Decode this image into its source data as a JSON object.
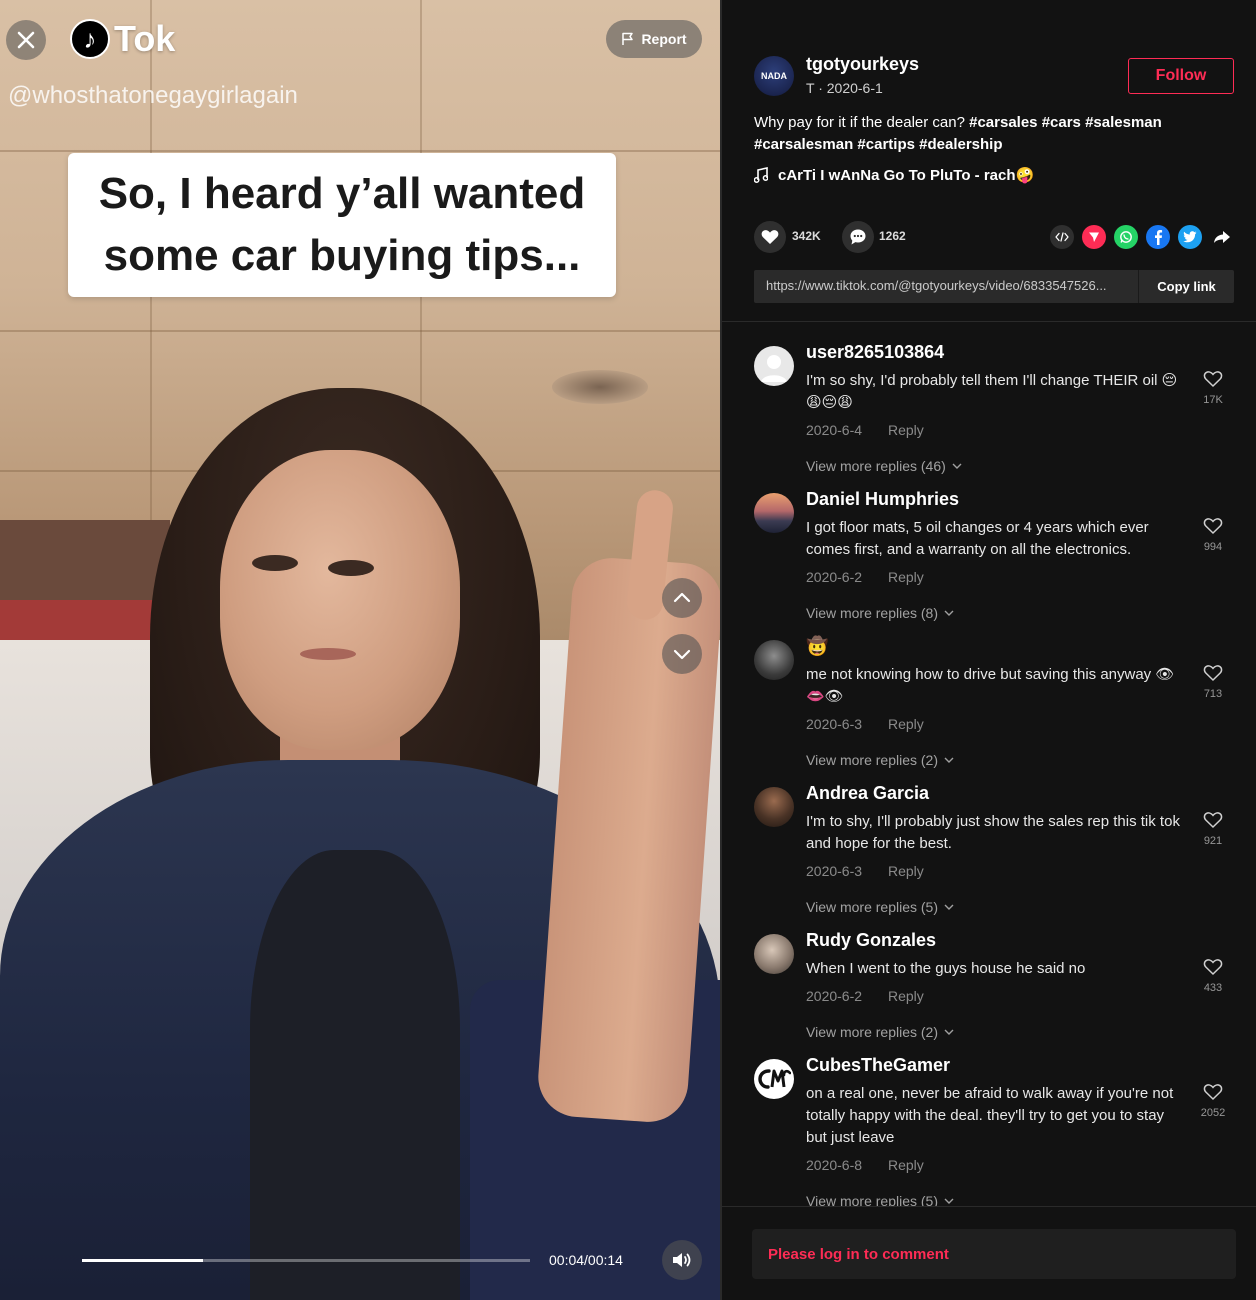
{
  "video": {
    "logo_text": "Tok",
    "watermark": "@whosthatonegaygirlagain",
    "caption_lines": [
      "So, I heard y’all wanted",
      "some car buying tips..."
    ],
    "report_label": "Report",
    "time": "00:04/00:14",
    "progress": 0.27
  },
  "author": {
    "username": "tgotyourkeys",
    "meta": "T · 2020-6-1",
    "avatar_text": "NADA",
    "follow_label": "Follow"
  },
  "description": {
    "text": "Why pay for it if the dealer can? ",
    "hashtags": [
      "#carsales",
      "#cars",
      "#salesman",
      "#carsalesman",
      "#cartips",
      "#dealership"
    ]
  },
  "music": "cArTi I wAnNa Go To PluTo - rach🤪",
  "actions": {
    "likes": "342K",
    "comments": "1262"
  },
  "share": {
    "url": "https://www.tiktok.com/@tgotyourkeys/video/6833547526...",
    "copy_label": "Copy link"
  },
  "comments": [
    {
      "user": "user8265103864",
      "text": "I'm so shy, I'd probably tell them I'll change THEIR oil 😔😩😔😩",
      "date": "2020-6-4",
      "reply": "Reply",
      "likes": "17K",
      "more": "View more replies (46)"
    },
    {
      "user": "Daniel Humphries",
      "text": "I got floor mats, 5 oil changes or 4 years which ever comes first, and a warranty on all the electronics.",
      "date": "2020-6-2",
      "reply": "Reply",
      "likes": "994",
      "more": "View more replies (8)"
    },
    {
      "user": "🤠",
      "text": "me not knowing how to drive but saving this anyway 👁👄👁",
      "date": "2020-6-3",
      "reply": "Reply",
      "likes": "713",
      "more": "View more replies (2)"
    },
    {
      "user": "Andrea Garcia",
      "text": "I'm to shy, I'll probably just show the sales rep this tik tok and hope for the best.",
      "date": "2020-6-3",
      "reply": "Reply",
      "likes": "921",
      "more": "View more replies (5)"
    },
    {
      "user": "Rudy Gonzales",
      "text": "When I went to the guys house he said no",
      "date": "2020-6-2",
      "reply": "Reply",
      "likes": "433",
      "more": "View more replies (2)"
    },
    {
      "user": "CubesTheGamer",
      "text": "on a real one, never be afraid to walk away if you're not totally happy with the deal. they'll try to get you to stay but just leave",
      "date": "2020-6-8",
      "reply": "Reply",
      "likes": "2052",
      "more": "View more replies (5)"
    }
  ],
  "comment_bar": "Please log in to comment",
  "colors": {
    "accent": "#fe2c55",
    "background": "#121212"
  }
}
